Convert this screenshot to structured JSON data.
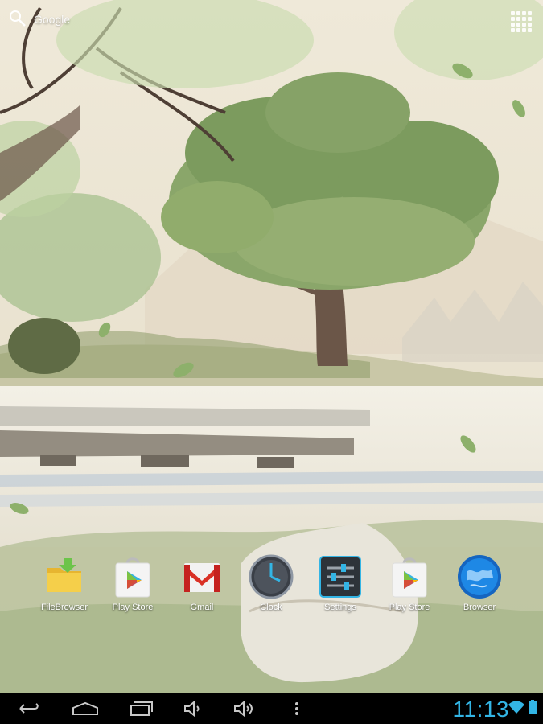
{
  "search": {
    "label": "Google"
  },
  "apps": [
    {
      "label": "FileBrowser",
      "icon": "folder-icon"
    },
    {
      "label": "Play Store",
      "icon": "play-store-icon"
    },
    {
      "label": "Gmail",
      "icon": "gmail-icon"
    },
    {
      "label": "Clock",
      "icon": "clock-icon"
    },
    {
      "label": "Settings",
      "icon": "settings-icon"
    },
    {
      "label": "Play Store",
      "icon": "play-store-icon"
    },
    {
      "label": "Browser",
      "icon": "globe-icon"
    }
  ],
  "status": {
    "time": "11:13"
  },
  "colors": {
    "accent": "#33b5e5",
    "navbar": "#000000"
  }
}
